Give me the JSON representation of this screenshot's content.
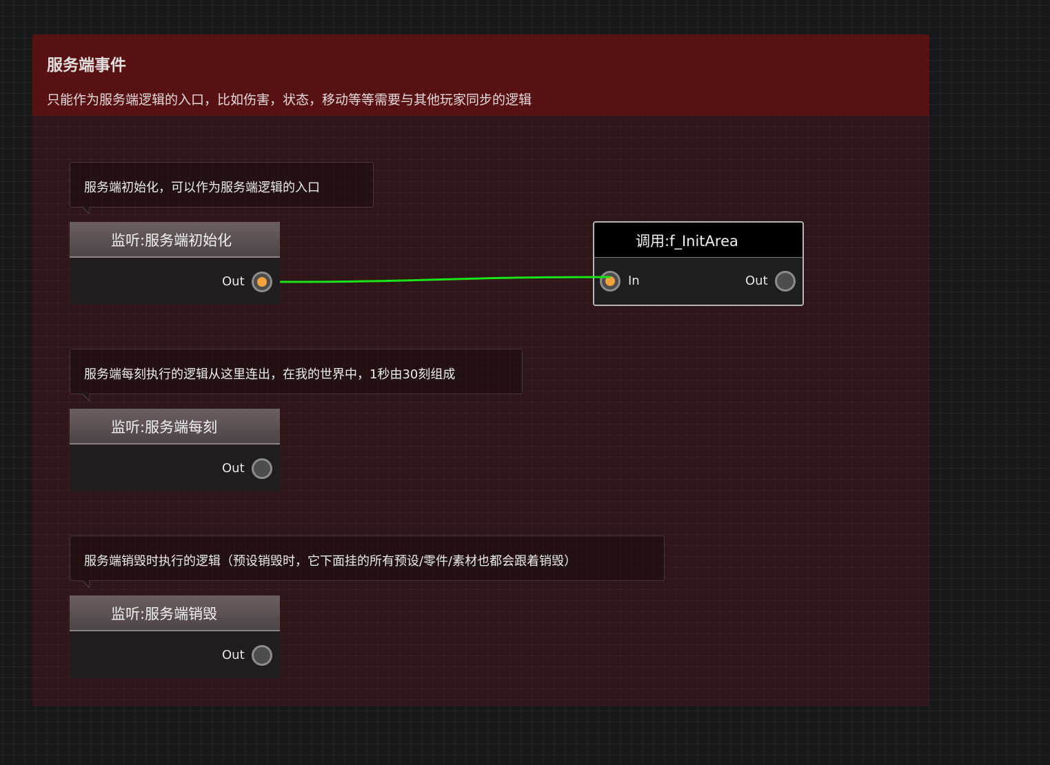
{
  "group": {
    "title": "服务端事件",
    "description": "只能作为服务端逻辑的入口，比如伤害，状态，移动等等需要与其他玩家同步的逻辑"
  },
  "comments": [
    {
      "text": "服务端初始化，可以作为服务端逻辑的入口"
    },
    {
      "text": "服务端每刻执行的逻辑从这里连出，在我的世界中，1秒由30刻组成"
    },
    {
      "text": "服务端销毁时执行的逻辑（预设销毁时，它下面挂的所有预设/零件/素材也都会跟着销毁）"
    }
  ],
  "nodes": [
    {
      "title": "监听:服务端初始化",
      "out_label": "Out",
      "out_connected": true
    },
    {
      "title": "监听:服务端每刻",
      "out_label": "Out",
      "out_connected": false
    },
    {
      "title": "监听:服务端销毁",
      "out_label": "Out",
      "out_connected": false
    }
  ],
  "call_node": {
    "title": "调用:f_InitArea",
    "in_label": "In",
    "out_label": "Out"
  },
  "colors": {
    "wire": "#19e619",
    "active_port": "#f2a13c",
    "group_header": "#5a1212"
  }
}
